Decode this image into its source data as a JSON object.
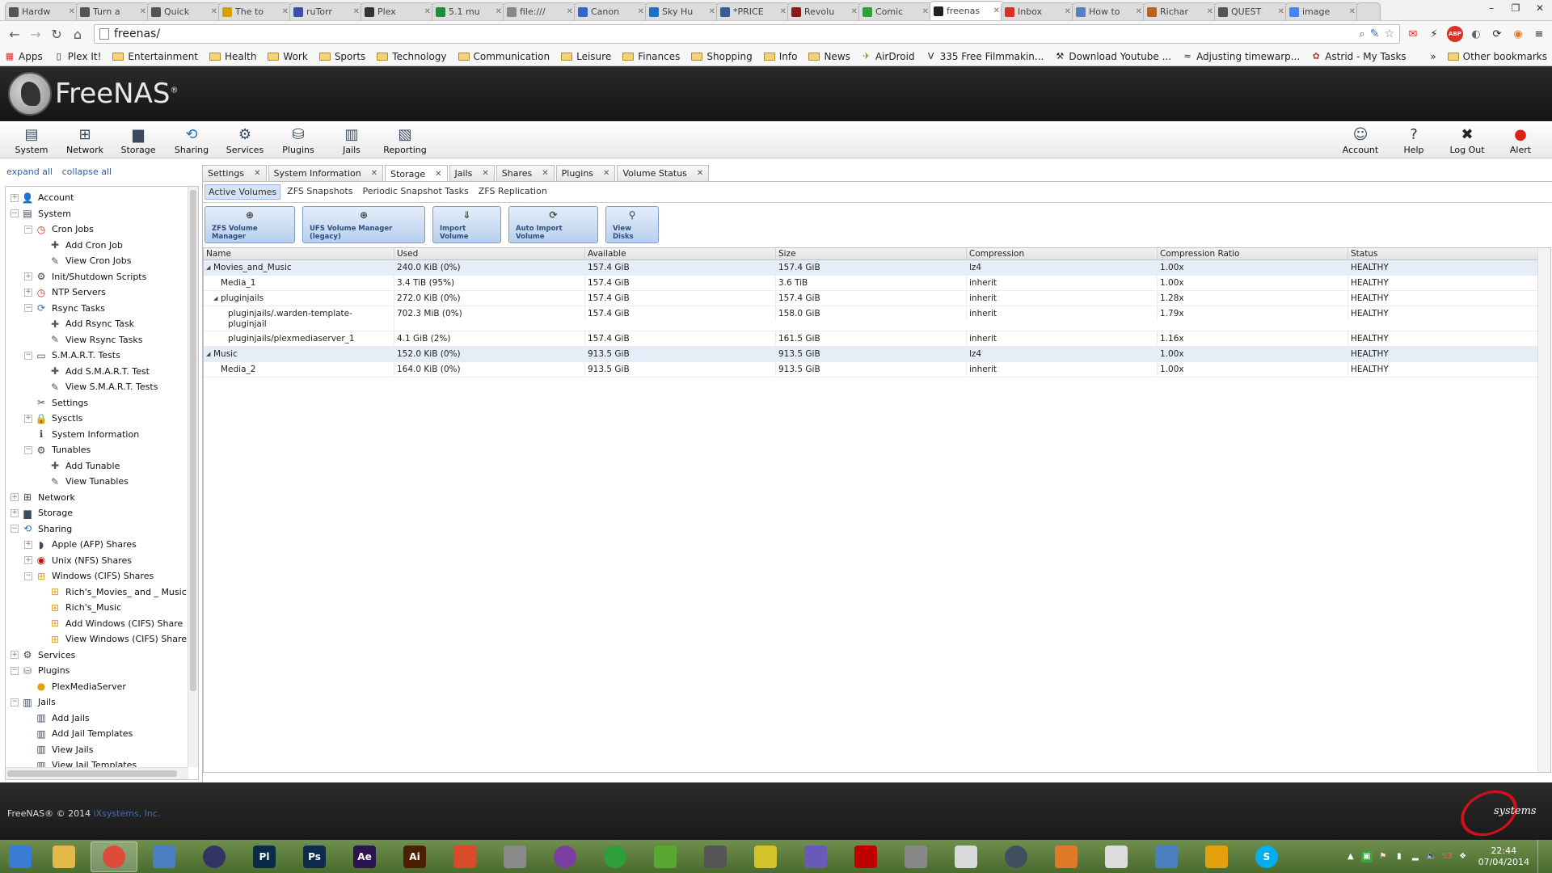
{
  "browser": {
    "tabs": [
      {
        "title": "Hardw",
        "color": "#555555"
      },
      {
        "title": "Turn a",
        "color": "#555555"
      },
      {
        "title": "Quick",
        "color": "#555555"
      },
      {
        "title": "The to",
        "color": "#d6a000"
      },
      {
        "title": "ruTorr",
        "color": "#3a4ea8"
      },
      {
        "title": "Plex",
        "color": "#333333"
      },
      {
        "title": "5.1 mu",
        "color": "#1e8e3e"
      },
      {
        "title": "file:///",
        "color": "#888888"
      },
      {
        "title": "Canon",
        "color": "#3366cc"
      },
      {
        "title": "Sky Hu",
        "color": "#1e6fc8"
      },
      {
        "title": "*PRICE",
        "color": "#3a5a9b"
      },
      {
        "title": "Revolu",
        "color": "#8b1a1a"
      },
      {
        "title": "Comic",
        "color": "#30a030"
      },
      {
        "title": "freenas",
        "color": "#222222",
        "active": true
      },
      {
        "title": "Inbox",
        "color": "#d93025"
      },
      {
        "title": "How to",
        "color": "#5b7fc4"
      },
      {
        "title": "Richar",
        "color": "#b5651d"
      },
      {
        "title": "QUEST",
        "color": "#555555"
      },
      {
        "title": "image",
        "color": "#4285f4"
      }
    ],
    "url": "freenas/",
    "bookmarks": [
      {
        "label": "Apps",
        "icon": "apps-grid"
      },
      {
        "label": "Plex It!",
        "icon": "page"
      },
      {
        "label": "Entertainment",
        "icon": "folder"
      },
      {
        "label": "Health",
        "icon": "folder"
      },
      {
        "label": "Work",
        "icon": "folder"
      },
      {
        "label": "Sports",
        "icon": "folder"
      },
      {
        "label": "Technology",
        "icon": "folder"
      },
      {
        "label": "Communication",
        "icon": "folder"
      },
      {
        "label": "Leisure",
        "icon": "folder"
      },
      {
        "label": "Finances",
        "icon": "folder"
      },
      {
        "label": "Shopping",
        "icon": "folder"
      },
      {
        "label": "Info",
        "icon": "folder"
      },
      {
        "label": "News",
        "icon": "folder"
      },
      {
        "label": "AirDroid",
        "icon": "airdroid"
      },
      {
        "label": "335 Free Filmmakin...",
        "icon": "v-logo"
      },
      {
        "label": "Download Youtube ...",
        "icon": "hammer"
      },
      {
        "label": "Adjusting timewarp...",
        "icon": "wave"
      },
      {
        "label": "Astrid - My Tasks",
        "icon": "astrid"
      }
    ],
    "bookmarks_overflow": "»",
    "other_bookmarks": "Other bookmarks"
  },
  "header": {
    "logo_text": "FreeNAS",
    "logo_mark": "®"
  },
  "toolbar": {
    "left": [
      "System",
      "Network",
      "Storage",
      "Sharing",
      "Services",
      "Plugins",
      "Jails",
      "Reporting"
    ],
    "right": [
      "Account",
      "Help",
      "Log Out",
      "Alert"
    ]
  },
  "tree": {
    "expand_all": "expand all",
    "collapse_all": "collapse all",
    "items": [
      {
        "label": "Account",
        "level": 0,
        "exp": "+",
        "icon": "account"
      },
      {
        "label": "System",
        "level": 0,
        "exp": "−",
        "icon": "system"
      },
      {
        "label": "Cron Jobs",
        "level": 1,
        "exp": "−",
        "icon": "clock"
      },
      {
        "label": "Add Cron Job",
        "level": 2,
        "exp": "",
        "icon": "add"
      },
      {
        "label": "View Cron Jobs",
        "level": 2,
        "exp": "",
        "icon": "view"
      },
      {
        "label": "Init/Shutdown Scripts",
        "level": 1,
        "exp": "+",
        "icon": "gear"
      },
      {
        "label": "NTP Servers",
        "level": 1,
        "exp": "+",
        "icon": "clock"
      },
      {
        "label": "Rsync Tasks",
        "level": 1,
        "exp": "−",
        "icon": "sync"
      },
      {
        "label": "Add Rsync Task",
        "level": 2,
        "exp": "",
        "icon": "add"
      },
      {
        "label": "View Rsync Tasks",
        "level": 2,
        "exp": "",
        "icon": "view"
      },
      {
        "label": "S.M.A.R.T. Tests",
        "level": 1,
        "exp": "−",
        "icon": "disk"
      },
      {
        "label": "Add S.M.A.R.T. Test",
        "level": 2,
        "exp": "",
        "icon": "add"
      },
      {
        "label": "View S.M.A.R.T. Tests",
        "level": 2,
        "exp": "",
        "icon": "view"
      },
      {
        "label": "Settings",
        "level": 1,
        "exp": "",
        "icon": "tools"
      },
      {
        "label": "Sysctls",
        "level": 1,
        "exp": "+",
        "icon": "lock"
      },
      {
        "label": "System Information",
        "level": 1,
        "exp": "",
        "icon": "info"
      },
      {
        "label": "Tunables",
        "level": 1,
        "exp": "−",
        "icon": "gear"
      },
      {
        "label": "Add Tunable",
        "level": 2,
        "exp": "",
        "icon": "add"
      },
      {
        "label": "View Tunables",
        "level": 2,
        "exp": "",
        "icon": "view"
      },
      {
        "label": "Network",
        "level": 0,
        "exp": "+",
        "icon": "network"
      },
      {
        "label": "Storage",
        "level": 0,
        "exp": "+",
        "icon": "storage"
      },
      {
        "label": "Sharing",
        "level": 0,
        "exp": "−",
        "icon": "sharing"
      },
      {
        "label": "Apple (AFP) Shares",
        "level": 1,
        "exp": "+",
        "icon": "apple"
      },
      {
        "label": "Unix (NFS) Shares",
        "level": 1,
        "exp": "+",
        "icon": "unix"
      },
      {
        "label": "Windows (CIFS) Shares",
        "level": 1,
        "exp": "−",
        "icon": "windows"
      },
      {
        "label": "Rich's_Movies_ and _ Music",
        "level": 2,
        "exp": "",
        "icon": "windows"
      },
      {
        "label": "Rich's_Music",
        "level": 2,
        "exp": "",
        "icon": "windows"
      },
      {
        "label": "Add Windows (CIFS) Share",
        "level": 2,
        "exp": "",
        "icon": "windows"
      },
      {
        "label": "View Windows (CIFS) Share",
        "level": 2,
        "exp": "",
        "icon": "windows"
      },
      {
        "label": "Services",
        "level": 0,
        "exp": "+",
        "icon": "services"
      },
      {
        "label": "Plugins",
        "level": 0,
        "exp": "−",
        "icon": "plugins"
      },
      {
        "label": "PlexMediaServer",
        "level": 1,
        "exp": "",
        "icon": "plex"
      },
      {
        "label": "Jails",
        "level": 0,
        "exp": "−",
        "icon": "jails"
      },
      {
        "label": "Add Jails",
        "level": 1,
        "exp": "",
        "icon": "jails"
      },
      {
        "label": "Add Jail Templates",
        "level": 1,
        "exp": "",
        "icon": "jails"
      },
      {
        "label": "View Jails",
        "level": 1,
        "exp": "",
        "icon": "jails"
      },
      {
        "label": "View Jail Templates",
        "level": 1,
        "exp": "",
        "icon": "jails"
      }
    ]
  },
  "main_tabs": [
    {
      "label": "Settings"
    },
    {
      "label": "System Information"
    },
    {
      "label": "Storage",
      "active": true
    },
    {
      "label": "Jails"
    },
    {
      "label": "Shares"
    },
    {
      "label": "Plugins"
    },
    {
      "label": "Volume Status"
    }
  ],
  "sub_tabs": [
    {
      "label": "Active Volumes",
      "active": true
    },
    {
      "label": "ZFS Snapshots"
    },
    {
      "label": "Periodic Snapshot Tasks"
    },
    {
      "label": "ZFS Replication"
    }
  ],
  "actions": [
    {
      "label": "ZFS Volume Manager",
      "icon": "volume-add"
    },
    {
      "label": "UFS Volume Manager (legacy)",
      "icon": "volume-add"
    },
    {
      "label": "Import Volume",
      "icon": "import"
    },
    {
      "label": "Auto Import Volume",
      "icon": "auto-import"
    },
    {
      "label": "View Disks",
      "icon": "disks"
    }
  ],
  "volumes": {
    "columns": [
      "Name",
      "Used",
      "Available",
      "Size",
      "Compression",
      "Compression Ratio",
      "Status"
    ],
    "rows": [
      {
        "name": "Movies_and_Music",
        "indent": 0,
        "toggle": "◢",
        "used": "240.0 KiB (0%)",
        "available": "157.4 GiB",
        "size": "157.4 GiB",
        "compression": "lz4",
        "ratio": "1.00x",
        "status": "HEALTHY",
        "selected": true
      },
      {
        "name": "Media_1",
        "indent": 1,
        "toggle": "",
        "used": "3.4 TiB (95%)",
        "available": "157.4 GiB",
        "size": "3.6 TiB",
        "compression": "inherit",
        "ratio": "1.00x",
        "status": "HEALTHY"
      },
      {
        "name": "pluginjails",
        "indent": 1,
        "toggle": "◢",
        "used": "272.0 KiB (0%)",
        "available": "157.4 GiB",
        "size": "157.4 GiB",
        "compression": "inherit",
        "ratio": "1.28x",
        "status": "HEALTHY"
      },
      {
        "name": "pluginjails/.warden-template-pluginjail",
        "indent": 2,
        "toggle": "",
        "used": "702.3 MiB (0%)",
        "available": "157.4 GiB",
        "size": "158.0 GiB",
        "compression": "inherit",
        "ratio": "1.79x",
        "status": "HEALTHY"
      },
      {
        "name": "pluginjails/plexmediaserver_1",
        "indent": 2,
        "toggle": "",
        "used": "4.1 GiB (2%)",
        "available": "157.4 GiB",
        "size": "161.5 GiB",
        "compression": "inherit",
        "ratio": "1.16x",
        "status": "HEALTHY"
      },
      {
        "name": "Music",
        "indent": 0,
        "toggle": "◢",
        "used": "152.0 KiB (0%)",
        "available": "913.5 GiB",
        "size": "913.5 GiB",
        "compression": "lz4",
        "ratio": "1.00x",
        "status": "HEALTHY",
        "selected": true
      },
      {
        "name": "Media_2",
        "indent": 1,
        "toggle": "",
        "used": "164.0 KiB (0%)",
        "available": "913.5 GiB",
        "size": "913.5 GiB",
        "compression": "inherit",
        "ratio": "1.00x",
        "status": "HEALTHY"
      }
    ]
  },
  "footer": {
    "copyright": "FreeNAS® © 2014",
    "company": "iXsystems, Inc.",
    "logo_text": "systems"
  },
  "taskbar": {
    "apps": [
      {
        "name": "windows-start",
        "label": "",
        "color": "#3a7bd5"
      },
      {
        "name": "file-explorer",
        "label": "",
        "color": "#e5b84a"
      },
      {
        "name": "chrome",
        "label": "",
        "color": "#dd4b39",
        "active": true
      },
      {
        "name": "control-panel",
        "label": "",
        "color": "#4a7fc1"
      },
      {
        "name": "media",
        "label": "",
        "color": "#333366"
      },
      {
        "name": "prelude",
        "label": "Pl",
        "color": "#0a2a4a"
      },
      {
        "name": "photoshop",
        "label": "Ps",
        "color": "#0c2b4d"
      },
      {
        "name": "after-effects",
        "label": "Ae",
        "color": "#2b1450"
      },
      {
        "name": "illustrator",
        "label": "Ai",
        "color": "#4a2000"
      },
      {
        "name": "paint",
        "label": "",
        "color": "#d84a2a"
      },
      {
        "name": "drive",
        "label": "",
        "color": "#8a8a8a"
      },
      {
        "name": "picasa",
        "label": "",
        "color": "#7a3fa0"
      },
      {
        "name": "home",
        "label": "",
        "color": "#2e9e3a"
      },
      {
        "name": "airdroid",
        "label": "",
        "color": "#5aa832"
      },
      {
        "name": "clapper",
        "label": "",
        "color": "#555555"
      },
      {
        "name": "banana",
        "label": "",
        "color": "#d4c22a"
      },
      {
        "name": "settings",
        "label": "",
        "color": "#6a5ab8"
      },
      {
        "name": "filezilla",
        "label": "",
        "color": "#bf0000"
      },
      {
        "name": "printer",
        "label": "",
        "color": "#888888"
      },
      {
        "name": "grid-app",
        "label": "",
        "color": "#d9d9d9"
      },
      {
        "name": "lotus",
        "label": "",
        "color": "#405060"
      },
      {
        "name": "tools",
        "label": "",
        "color": "#e07a2a"
      },
      {
        "name": "alien",
        "label": "",
        "color": "#dddddd"
      },
      {
        "name": "usb",
        "label": "",
        "color": "#4a80c0"
      },
      {
        "name": "plex",
        "label": "",
        "color": "#e5a00d"
      },
      {
        "name": "skype",
        "label": "S",
        "color": "#00aff0"
      }
    ],
    "time": "22:44",
    "date": "07/04/2014",
    "tray_badge": "53"
  }
}
